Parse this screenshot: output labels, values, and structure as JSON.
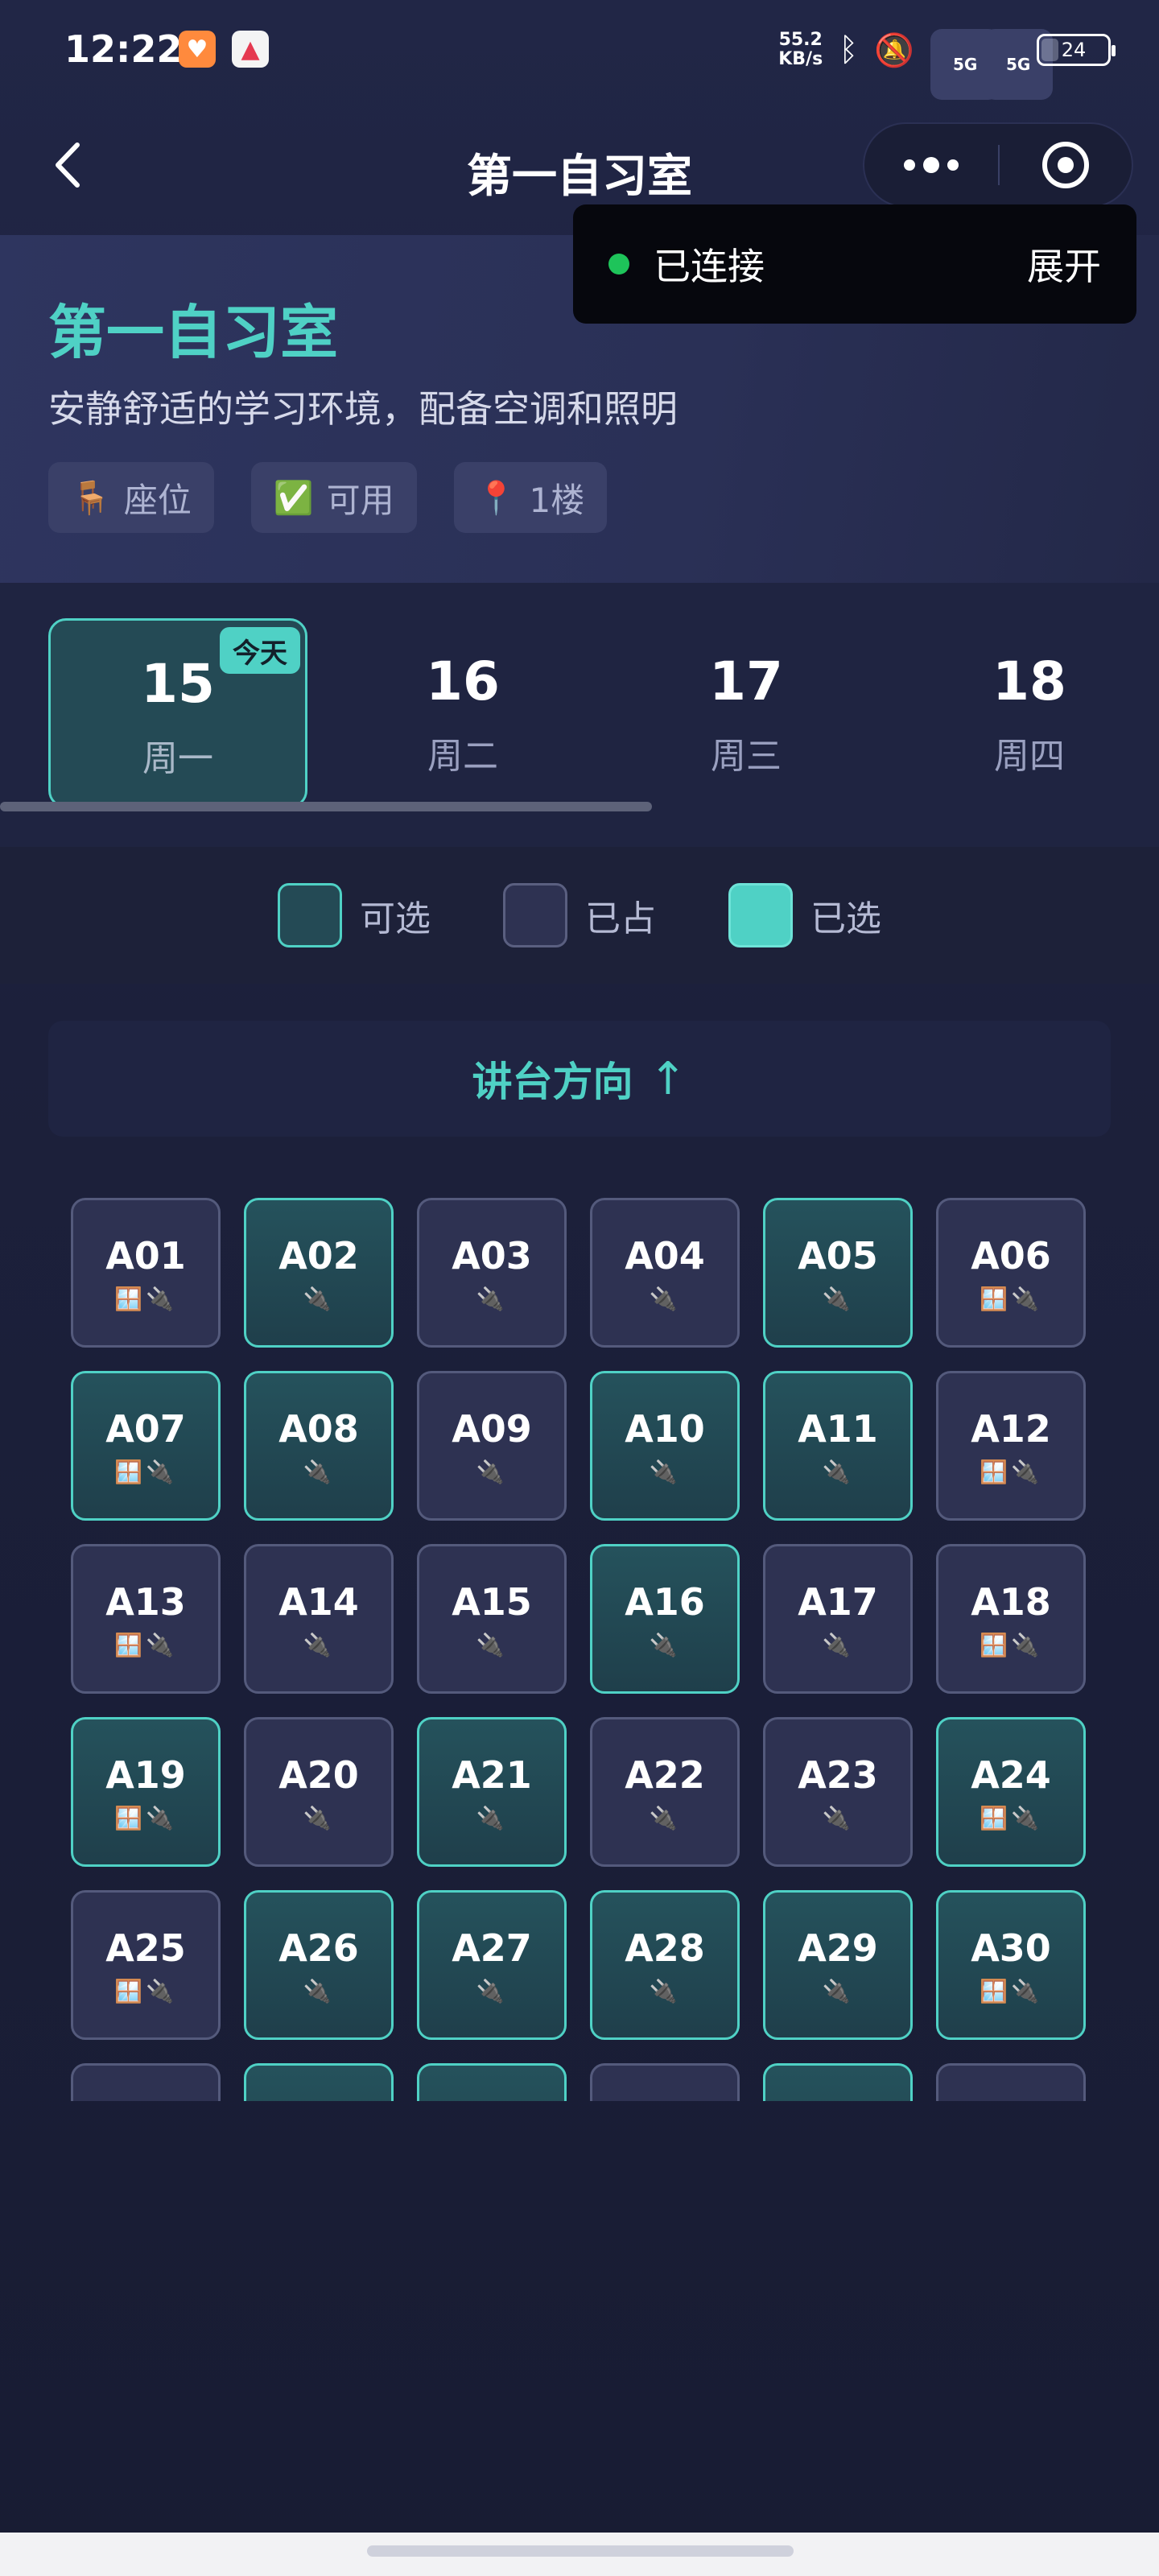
{
  "status_bar": {
    "time": "12:22",
    "net_speed_value": "55.2",
    "net_speed_unit": "KB/s",
    "signal1": "5G",
    "signal2": "5G",
    "battery": "24"
  },
  "nav": {
    "title": "第一自习室"
  },
  "connection": {
    "status": "已连接",
    "expand_label": "展开",
    "status_color": "#1ec45a"
  },
  "room": {
    "name": "第一自习室",
    "description": "安静舒适的学习环境，配备空调和照明",
    "tags": [
      {
        "icon": "🪑",
        "label": "座位"
      },
      {
        "icon": "✅",
        "label": "可用"
      },
      {
        "icon": "📍",
        "label": "1楼"
      }
    ]
  },
  "dates": [
    {
      "day": "15",
      "weekday": "周一",
      "badge": "今天"
    },
    {
      "day": "16",
      "weekday": "周二"
    },
    {
      "day": "17",
      "weekday": "周三"
    },
    {
      "day": "18",
      "weekday": "周四"
    }
  ],
  "legend": [
    {
      "label": "可选",
      "state": "avail"
    },
    {
      "label": "已占",
      "state": "occ"
    },
    {
      "label": "已选",
      "state": "sel"
    }
  ],
  "stage": {
    "label": "讲台方向",
    "arrow": "↑"
  },
  "colors": {
    "accent": "#4fd1c5",
    "background": "#1b1f38"
  },
  "seats": [
    {
      "code": "A01",
      "state": "occ",
      "features": "🪟🔌"
    },
    {
      "code": "A02",
      "state": "avail",
      "features": "🔌"
    },
    {
      "code": "A03",
      "state": "occ",
      "features": "🔌"
    },
    {
      "code": "A04",
      "state": "occ",
      "features": "🔌"
    },
    {
      "code": "A05",
      "state": "avail",
      "features": "🔌"
    },
    {
      "code": "A06",
      "state": "occ",
      "features": "🪟🔌"
    },
    {
      "code": "A07",
      "state": "avail",
      "features": "🪟🔌"
    },
    {
      "code": "A08",
      "state": "avail",
      "features": "🔌"
    },
    {
      "code": "A09",
      "state": "occ",
      "features": "🔌"
    },
    {
      "code": "A10",
      "state": "avail",
      "features": "🔌"
    },
    {
      "code": "A11",
      "state": "avail",
      "features": "🔌"
    },
    {
      "code": "A12",
      "state": "occ",
      "features": "🪟🔌"
    },
    {
      "code": "A13",
      "state": "occ",
      "features": "🪟🔌"
    },
    {
      "code": "A14",
      "state": "occ",
      "features": "🔌"
    },
    {
      "code": "A15",
      "state": "occ",
      "features": "🔌"
    },
    {
      "code": "A16",
      "state": "avail",
      "features": "🔌"
    },
    {
      "code": "A17",
      "state": "occ",
      "features": "🔌"
    },
    {
      "code": "A18",
      "state": "occ",
      "features": "🪟🔌"
    },
    {
      "code": "A19",
      "state": "avail",
      "features": "🪟🔌"
    },
    {
      "code": "A20",
      "state": "occ",
      "features": "🔌"
    },
    {
      "code": "A21",
      "state": "avail",
      "features": "🔌"
    },
    {
      "code": "A22",
      "state": "occ",
      "features": "🔌"
    },
    {
      "code": "A23",
      "state": "occ",
      "features": "🔌"
    },
    {
      "code": "A24",
      "state": "avail",
      "features": "🪟🔌"
    },
    {
      "code": "A25",
      "state": "occ",
      "features": "🪟🔌"
    },
    {
      "code": "A26",
      "state": "avail",
      "features": "🔌"
    },
    {
      "code": "A27",
      "state": "avail",
      "features": "🔌"
    },
    {
      "code": "A28",
      "state": "avail",
      "features": "🔌"
    },
    {
      "code": "A29",
      "state": "avail",
      "features": "🔌"
    },
    {
      "code": "A30",
      "state": "avail",
      "features": "🪟🔌"
    },
    {
      "code": "",
      "state": "occ",
      "features": ""
    },
    {
      "code": "",
      "state": "avail",
      "features": ""
    },
    {
      "code": "",
      "state": "avail",
      "features": ""
    },
    {
      "code": "",
      "state": "occ",
      "features": ""
    },
    {
      "code": "",
      "state": "avail",
      "features": ""
    },
    {
      "code": "",
      "state": "occ",
      "features": ""
    }
  ]
}
